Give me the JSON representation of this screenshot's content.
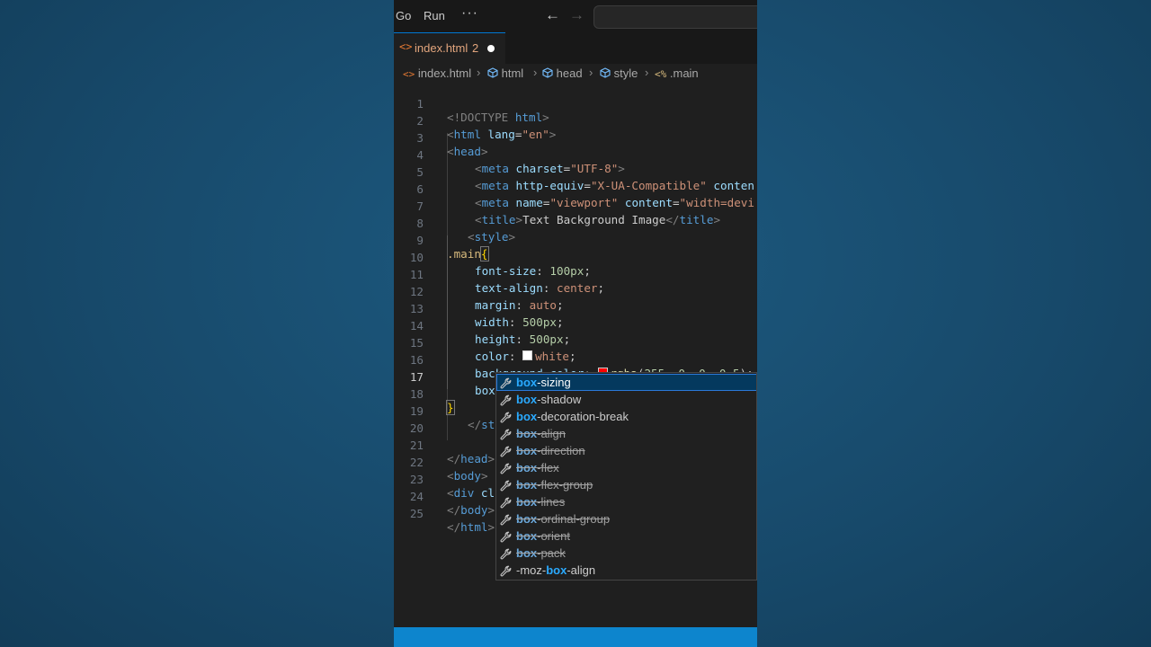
{
  "menu": {
    "go": "Go",
    "run": "Run",
    "more": "···",
    "back_icon": "arrow-left-icon",
    "forward_icon": "arrow-right-icon"
  },
  "tab": {
    "icon": "<>",
    "label": "index.html",
    "badge": "2",
    "modified": true
  },
  "breadcrumb": {
    "file_icon": "<>",
    "items": [
      "index.html",
      "html",
      "head",
      "style",
      ".main"
    ]
  },
  "editor": {
    "active_line": 17,
    "line_numbers": [
      "1",
      "2",
      "3",
      "4",
      "5",
      "6",
      "7",
      "8",
      "9",
      "10",
      "11",
      "12",
      "13",
      "14",
      "15",
      "16",
      "17",
      "18",
      "19",
      "20",
      "21",
      "22",
      "23",
      "24",
      "25"
    ],
    "lines": {
      "l1": {
        "a": "<!DOCTYPE ",
        "b": "html",
        "c": ">"
      },
      "l2": {
        "a": "<",
        "b": "html",
        "c": " lang",
        "d": "=",
        "e": "\"en\"",
        "f": ">"
      },
      "l3": {
        "a": "<",
        "b": "head",
        "c": ">"
      },
      "l4": {
        "a": "<",
        "b": "meta",
        "c": " charset",
        "d": "=",
        "e": "\"UTF-8\"",
        "f": ">"
      },
      "l5": {
        "a": "<",
        "b": "meta",
        "c": " http-equiv",
        "d": "=",
        "e": "\"X-UA-Compatible\"",
        "f": " conten"
      },
      "l6": {
        "a": "<",
        "b": "meta",
        "c": " name",
        "d": "=",
        "e": "\"viewport\"",
        "f": " content",
        "g": "=",
        "h": "\"width=devi"
      },
      "l7": {
        "a": "<",
        "b": "title",
        "c": ">",
        "d": "Text Background Image",
        "e": "</",
        "f": "title",
        "g": ">"
      },
      "l8": {
        "a": "<",
        "b": "style",
        "c": ">"
      },
      "l9": {
        "a": ".main",
        "b": "{"
      },
      "l10": {
        "a": "font-size",
        "b": ": ",
        "c": "100px",
        "d": ";"
      },
      "l11": {
        "a": "text-align",
        "b": ": ",
        "c": "center",
        "d": ";"
      },
      "l12": {
        "a": "margin",
        "b": ": ",
        "c": "auto",
        "d": ";"
      },
      "l13": {
        "a": "width",
        "b": ": ",
        "c": "500px",
        "d": ";"
      },
      "l14": {
        "a": "height",
        "b": ": ",
        "c": "500px",
        "d": ";"
      },
      "l15": {
        "a": "color",
        "b": ": ",
        "c": "white",
        "d": ";",
        "swatch": "#ffffff"
      },
      "l16": {
        "a": "background-color",
        "b": ": ",
        "c": "rgba",
        "d": "(",
        "e": "255",
        "f": ", ",
        "g": "0",
        "h": ", ",
        "i": "0",
        "j": ", ",
        "k": "0.5",
        "l": ");",
        "swatch": "#ff0000"
      },
      "l17": {
        "a": "box"
      },
      "l18": {
        "a": "}"
      },
      "l19": {
        "a": "</",
        "b": "st"
      },
      "l20": {
        "a": ""
      },
      "l21": {
        "a": "</",
        "b": "head",
        "c": ">"
      },
      "l22": {
        "a": "<",
        "b": "body",
        "c": ">"
      },
      "l23": {
        "a": "<",
        "b": "div",
        "c": " cl"
      },
      "l24": {
        "a": "</",
        "b": "body",
        "c": ">"
      },
      "l25": {
        "a": "</",
        "b": "html",
        "c": ">"
      }
    }
  },
  "suggest": {
    "typed": "box",
    "items": [
      {
        "match": "box",
        "rest": "-sizing",
        "pre": "",
        "deprecated": false,
        "selected": true
      },
      {
        "match": "box",
        "rest": "-shadow",
        "pre": "",
        "deprecated": false,
        "selected": false
      },
      {
        "match": "box",
        "rest": "-decoration-break",
        "pre": "",
        "deprecated": false,
        "selected": false
      },
      {
        "match": "box",
        "rest": "-align",
        "pre": "",
        "deprecated": true,
        "selected": false
      },
      {
        "match": "box",
        "rest": "-direction",
        "pre": "",
        "deprecated": true,
        "selected": false
      },
      {
        "match": "box",
        "rest": "-flex",
        "pre": "",
        "deprecated": true,
        "selected": false
      },
      {
        "match": "box",
        "rest": "-flex-group",
        "pre": "",
        "deprecated": true,
        "selected": false
      },
      {
        "match": "box",
        "rest": "-lines",
        "pre": "",
        "deprecated": true,
        "selected": false
      },
      {
        "match": "box",
        "rest": "-ordinal-group",
        "pre": "",
        "deprecated": true,
        "selected": false
      },
      {
        "match": "box",
        "rest": "-orient",
        "pre": "",
        "deprecated": true,
        "selected": false
      },
      {
        "match": "box",
        "rest": "-pack",
        "pre": "",
        "deprecated": true,
        "selected": false
      },
      {
        "match": "box",
        "rest": "-align",
        "pre": "-moz-",
        "deprecated": false,
        "selected": false
      }
    ],
    "item_icon": "wrench-icon"
  },
  "colors": {
    "accent": "#0078d4",
    "statusbar": "#0d85cd",
    "editor_bg": "#1f1f1f"
  }
}
